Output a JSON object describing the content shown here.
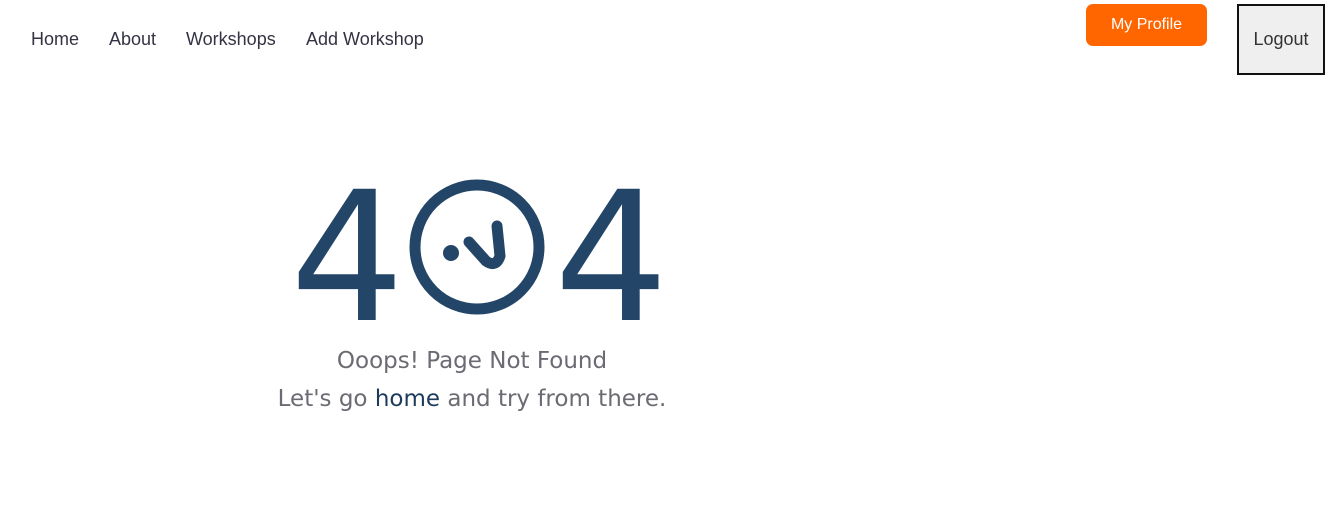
{
  "nav": {
    "links": [
      {
        "label": "Home"
      },
      {
        "label": "About"
      },
      {
        "label": "Workshops"
      },
      {
        "label": "Add Workshop"
      }
    ],
    "profile_button": "My Profile",
    "logout_button": "Logout"
  },
  "error": {
    "digit_left": "4",
    "digit_right": "4",
    "title": "Ooops! Page Not Found",
    "sub_before": "Let's go ",
    "sub_link": "home",
    "sub_after": " and try from there."
  },
  "colors": {
    "accent": "#ff6600",
    "error_code": "#234567",
    "message_text": "#6b6b73",
    "link": "#1d3b5c"
  },
  "icons": {
    "error_face": "sad-face-icon"
  }
}
